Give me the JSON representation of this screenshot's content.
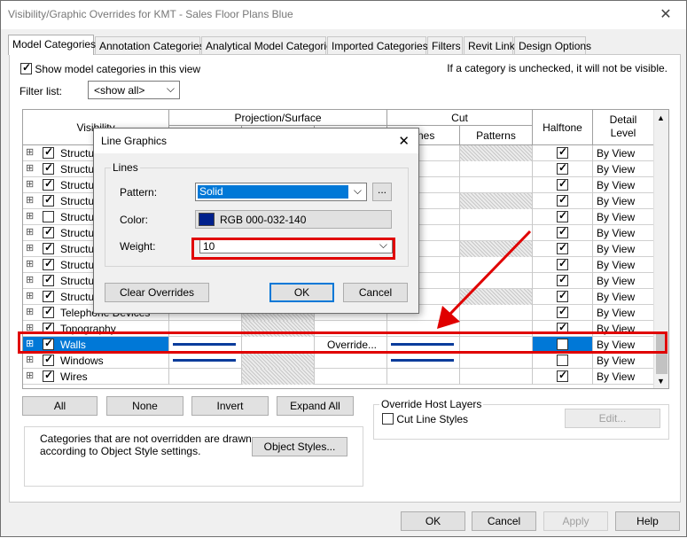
{
  "window": {
    "title": "Visibility/Graphic Overrides for KMT - Sales Floor Plans Blue",
    "close": "✕"
  },
  "tabs": [
    "Model Categories",
    "Annotation Categories",
    "Analytical Model Categories",
    "Imported Categories",
    "Filters",
    "Revit Links",
    "Design Options"
  ],
  "top": {
    "show_label": "Show model categories in this view",
    "hint": "If a category is unchecked, it will not be visible.",
    "filter_label": "Filter list:",
    "filter_value": "<show all>"
  },
  "grid": {
    "headers": {
      "visibility": "Visibility",
      "projection": "Projection/Surface",
      "cut": "Cut",
      "lines_partial": "nes",
      "patterns": "Patterns",
      "halftone": "Halftone",
      "detail_level": "Detail Level"
    },
    "rows": [
      {
        "name": "Structu",
        "checked": true,
        "halftone": true,
        "detail": "By View"
      },
      {
        "name": "Structu",
        "checked": true,
        "halftone": true,
        "detail": "By View"
      },
      {
        "name": "Structu",
        "checked": true,
        "halftone": true,
        "detail": "By View"
      },
      {
        "name": "Structu",
        "checked": true,
        "halftone": true,
        "detail": "By View"
      },
      {
        "name": "Structu",
        "checked": false,
        "halftone": true,
        "detail": "By View"
      },
      {
        "name": "Structu",
        "checked": true,
        "halftone": true,
        "detail": "By View"
      },
      {
        "name": "Structu",
        "checked": true,
        "halftone": true,
        "detail": "By View"
      },
      {
        "name": "Structu",
        "checked": true,
        "halftone": true,
        "detail": "By View"
      },
      {
        "name": "Structu",
        "checked": true,
        "halftone": true,
        "detail": "By View"
      },
      {
        "name": "Structu",
        "checked": true,
        "halftone": true,
        "detail": "By View"
      },
      {
        "name": "Telephone Devices",
        "checked": true,
        "halftone": true,
        "detail": "By View"
      },
      {
        "name": "Topography",
        "checked": true,
        "halftone": true,
        "detail": "By View"
      },
      {
        "name": "Walls",
        "checked": true,
        "halftone": false,
        "detail": "By View",
        "selected": true,
        "override": "Override..."
      },
      {
        "name": "Windows",
        "checked": true,
        "halftone": false,
        "detail": "By View"
      },
      {
        "name": "Wires",
        "checked": true,
        "halftone": true,
        "detail": "By View"
      }
    ]
  },
  "buttons": {
    "all": "All",
    "none": "None",
    "invert": "Invert",
    "expand_all": "Expand All"
  },
  "info": {
    "text1": "Categories that are not overridden are drawn",
    "text2": "according to Object Style settings.",
    "object_styles": "Object Styles..."
  },
  "override_host": {
    "title": "Override Host Layers",
    "cut_line": "Cut Line Styles",
    "edit": "Edit..."
  },
  "footer": {
    "ok": "OK",
    "cancel": "Cancel",
    "apply": "Apply",
    "help": "Help"
  },
  "dialog": {
    "title": "Line Graphics",
    "close": "✕",
    "group": "Lines",
    "pattern_label": "Pattern:",
    "pattern_value": "Solid",
    "ellipsis": "...",
    "color_label": "Color:",
    "color_value": "RGB 000-032-140",
    "color_hex": "#00208c",
    "weight_label": "Weight:",
    "weight_value": "10",
    "clear": "Clear Overrides",
    "ok": "OK",
    "cancel": "Cancel"
  },
  "colors": {
    "highlight": "#e00000",
    "selection": "#0078d7",
    "line_blue": "#0a3c9c"
  }
}
